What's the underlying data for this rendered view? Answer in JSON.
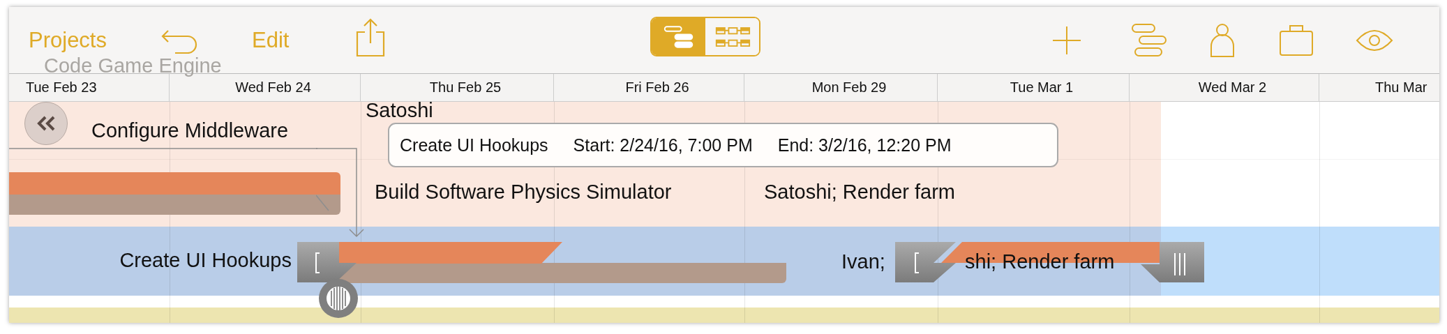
{
  "toolbar": {
    "left": [
      {
        "kind": "text",
        "label": "Projects"
      },
      {
        "kind": "undo"
      },
      {
        "kind": "text",
        "label": "Edit"
      },
      {
        "kind": "share"
      }
    ],
    "view_switch": [
      {
        "kind": "gantt",
        "selected": true
      },
      {
        "kind": "network",
        "selected": false
      }
    ],
    "right": [
      {
        "kind": "add"
      },
      {
        "kind": "gantt"
      },
      {
        "kind": "person"
      },
      {
        "kind": "briefcase"
      },
      {
        "kind": "eye"
      }
    ]
  },
  "project_title": "Code Game Engine",
  "days": [
    "Tue Feb 23",
    "Wed Feb 24",
    "Thu Feb 25",
    "Fri Feb 26",
    "Mon Feb 29",
    "Tue Mar 1",
    "Wed Mar 2",
    "Thu Mar"
  ],
  "rows": [
    {
      "name": "Configure Middleware",
      "resources": [
        "Satoshi"
      ],
      "selected": false
    },
    {
      "name": "Build Software Physics Simulator",
      "resources": [
        "Satoshi; Render farm"
      ],
      "selected": false,
      "bar": {
        "level": 1
      }
    },
    {
      "name": "Create UI Hookups",
      "resources": [
        "Ivan;",
        "shi; Render farm"
      ],
      "selected": true,
      "bar": {
        "level": 0.5
      }
    }
  ],
  "tooltip": {
    "name": "Create UI Hookups",
    "start": "Start: 2/24/16, 7:00 PM",
    "end": "End: 3/2/16, 12:20 PM"
  }
}
